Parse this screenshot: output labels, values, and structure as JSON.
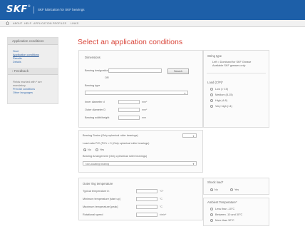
{
  "header": {
    "logo": "SKF",
    "logo_sup": "®",
    "subtitle": "SKF lubrication for SKF bearings"
  },
  "nav": {
    "items": [
      "ABOUT",
      "HELP",
      "APPLICATION PROFILES",
      "LINKS"
    ]
  },
  "sidebar": {
    "title": "Application conditions",
    "links": [
      "Start",
      "Application conditions",
      "Results",
      "Details"
    ],
    "feedback_title": "Feedback",
    "note_lines": [
      "Fields marked with * are",
      "mandatory"
    ],
    "help_links": [
      "Print All conditions",
      "Other languages"
    ]
  },
  "main": {
    "title": "Select an application conditions"
  },
  "dimensions": {
    "title": "Dimensions",
    "designation_label": "Bearing designation",
    "designation_value": "",
    "search_button": "Search",
    "or_label": "OR",
    "bearing_type_label": "Bearing type",
    "bearing_type_value": "",
    "rows": [
      {
        "label": "Inner diameter d",
        "value": "",
        "unit": "mm*"
      },
      {
        "label": "Outer diameter D",
        "value": "",
        "unit": "mm*"
      },
      {
        "label": "Bearing width/height",
        "value": "",
        "unit": "mm"
      }
    ]
  },
  "bearing_options": {
    "series_label": "Bearing Series (Only spherical roller bearings)",
    "series_value": "",
    "load_label": "Load ratio P/C (P/Cr < 0 (Only spherical roller bearings)",
    "load_options": [
      {
        "label": "No",
        "selected": true
      },
      {
        "label": "Yes",
        "selected": false
      }
    ],
    "arrangement_label": "Bearing Arrangement (Only cylindrical roller bearings)",
    "arrangement_value": "Non-locating bearing"
  },
  "temperature": {
    "title": "Outer ring temperature",
    "rows": [
      {
        "label": "Typical temperature in",
        "value": "",
        "unit": "°C*"
      },
      {
        "label": "Minimum temperature [start up]",
        "value": "",
        "unit": "°C"
      },
      {
        "label": "Maximum temperature [peak]",
        "value": "",
        "unit": "°C"
      },
      {
        "label": "Rotational speed",
        "value": "",
        "unit": "r/min*"
      }
    ]
  },
  "right_panels": {
    "string_type": {
      "title": "String type",
      "lines": [
        "Left = Dominant for SKF Grease",
        "Available SKF greases only"
      ]
    },
    "load": {
      "title": "Load (C/P)*",
      "options": [
        {
          "label": "Low (> 15)",
          "selected": false
        },
        {
          "label": "Medium (8-15)",
          "selected": false
        },
        {
          "label": "High (4-8)",
          "selected": false
        },
        {
          "label": "Very high (<4)",
          "selected": false
        }
      ]
    },
    "shock": {
      "title": "Shock load*",
      "options": [
        {
          "label": "No",
          "selected": true
        },
        {
          "label": "Yes",
          "selected": false
        }
      ]
    },
    "ambient": {
      "title": "Ambient Temperature*",
      "options": [
        {
          "label": "Less than -10°C",
          "selected": false
        },
        {
          "label": "Between -10 and 30°C",
          "selected": false
        },
        {
          "label": "More than 30°C",
          "selected": false
        }
      ]
    }
  },
  "colors": {
    "brand": "#1d5fa8",
    "title_red": "#d9463a",
    "link_blue": "#3a6fb0"
  }
}
